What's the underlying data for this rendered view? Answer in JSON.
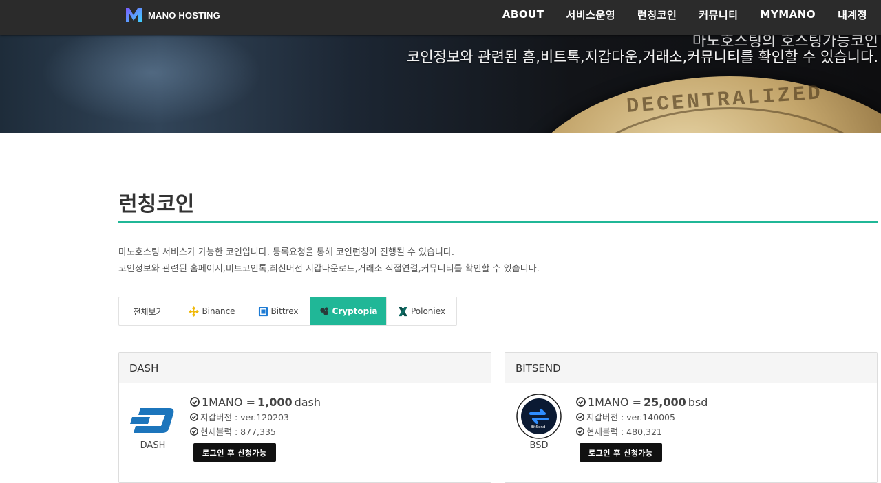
{
  "brand": {
    "name": "MANO HOSTING"
  },
  "nav": {
    "items": [
      "ABOUT",
      "서비스운영",
      "런칭코인",
      "커뮤니티",
      "MYMANO",
      "내계정"
    ]
  },
  "hero": {
    "line1": "마노호스팅의 호스팅가능코인",
    "line2": "코인정보와 관련된 홈,비트톡,지갑다운,거래소,커뮤니티를 확인할 수 있습니다.",
    "coin_text": "DECENTRALIZED"
  },
  "page": {
    "title": "런칭코인",
    "desc_line1": "마노호스팅 서비스가 가능한 코인입니다. 등록요청을 통해 코인런칭이 진행될 수 있습니다.",
    "desc_line2": "코인정보와 관련된 홈페이지,비트코인톡,최신버전 지갑다운로드,거래소 직접연결,커뮤니티를 확인할 수 있습니다."
  },
  "tabs": [
    {
      "label": "전체보기",
      "icon": "none"
    },
    {
      "label": "Binance",
      "icon": "binance-icon"
    },
    {
      "label": "Bittrex",
      "icon": "bittrex-icon"
    },
    {
      "label": "Cryptopia",
      "icon": "cryptopia-icon",
      "active": true
    },
    {
      "label": "Poloniex",
      "icon": "poloniex-icon"
    }
  ],
  "cards": [
    {
      "header": "DASH",
      "symbol": "DASH",
      "rate_prefix": "1MANO =",
      "rate_value": "1,000",
      "rate_unit": "dash",
      "wallet": "지갑버전 : ver.120203",
      "block": "현재블럭 : 877,335",
      "button": "로그인 후 신청가능"
    },
    {
      "header": "BITSEND",
      "symbol": "BSD",
      "logo_text": "BitSend",
      "rate_prefix": "1MANO =",
      "rate_value": "25,000",
      "rate_unit": "bsd",
      "wallet": "지갑버전 : ver.140005",
      "block": "현재블럭 : 480,321",
      "button": "로그인 후 신청가능"
    }
  ],
  "colors": {
    "accent": "#20b797",
    "nav_bg": "#2b2b2b",
    "button_bg": "#111111"
  }
}
